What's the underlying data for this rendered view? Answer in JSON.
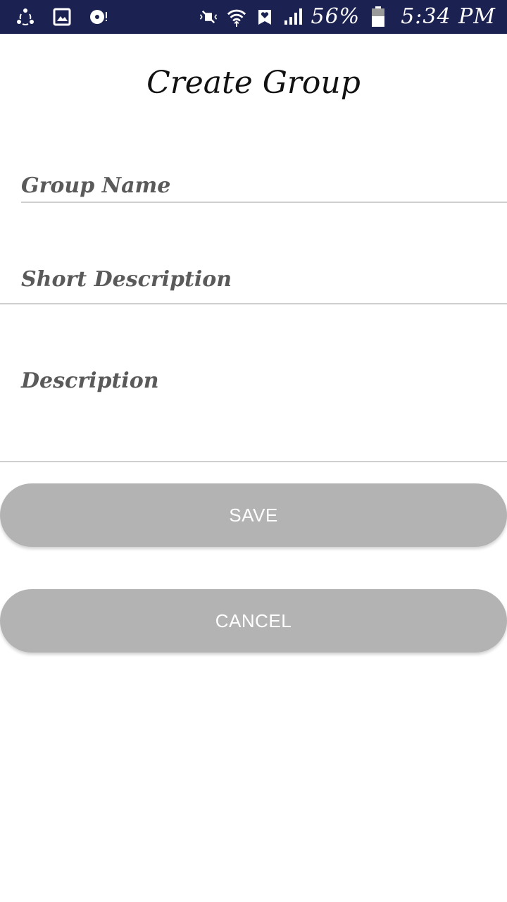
{
  "status_bar": {
    "battery_text": "56%",
    "time_text": "5:34 PM",
    "icons_left": [
      "share-icon",
      "gallery-icon",
      "disc-icon"
    ],
    "icons_right": [
      "mute-icon",
      "wifi-icon",
      "heart-icon",
      "signal-icon",
      "battery-icon"
    ],
    "bg_color": "#1b2150"
  },
  "page": {
    "title": "Create Group"
  },
  "form": {
    "group_name_placeholder": "Group Name",
    "short_description_placeholder": "Short Description",
    "description_placeholder": "Description"
  },
  "buttons": {
    "save_label": "SAVE",
    "cancel_label": "CANCEL",
    "color": "#b3b3b3"
  }
}
